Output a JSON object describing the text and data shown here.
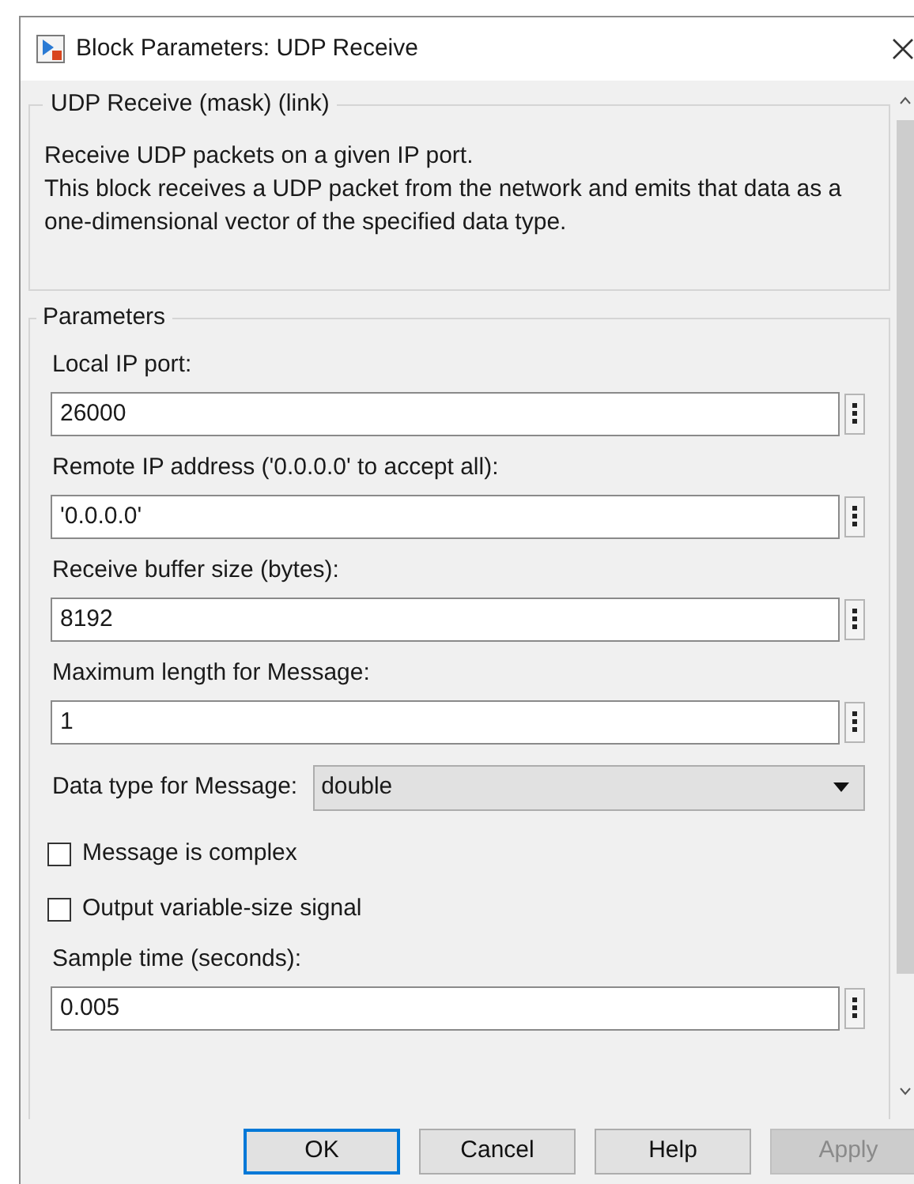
{
  "window": {
    "title": "Block Parameters: UDP Receive"
  },
  "description": {
    "legend": "UDP Receive (mask) (link)",
    "lines": [
      "Receive UDP packets on a given IP port.",
      "This block receives a UDP packet from the network and emits that data as a one-dimensional vector of the specified data type."
    ]
  },
  "parameters": {
    "legend": "Parameters",
    "items": [
      {
        "kind": "text",
        "label": "Local IP port:",
        "value": "26000"
      },
      {
        "kind": "text",
        "label": "Remote IP address ('0.0.0.0' to accept all):",
        "value": "'0.0.0.0'"
      },
      {
        "kind": "text",
        "label": "Receive buffer size (bytes):",
        "value": "8192"
      },
      {
        "kind": "text",
        "label": "Maximum length for Message:",
        "value": "1"
      },
      {
        "kind": "dropdown",
        "label": "Data type for Message:",
        "value": "double"
      },
      {
        "kind": "checkbox",
        "label": "Message is complex",
        "checked": false
      },
      {
        "kind": "checkbox",
        "label": "Output variable-size signal",
        "checked": false
      },
      {
        "kind": "text",
        "label": "Sample time (seconds):",
        "value": "0.005"
      }
    ]
  },
  "buttons": [
    {
      "label": "OK",
      "focused": true,
      "disabled": false
    },
    {
      "label": "Cancel",
      "focused": false,
      "disabled": false
    },
    {
      "label": "Help",
      "focused": false,
      "disabled": false
    },
    {
      "label": "Apply",
      "focused": false,
      "disabled": true
    }
  ]
}
